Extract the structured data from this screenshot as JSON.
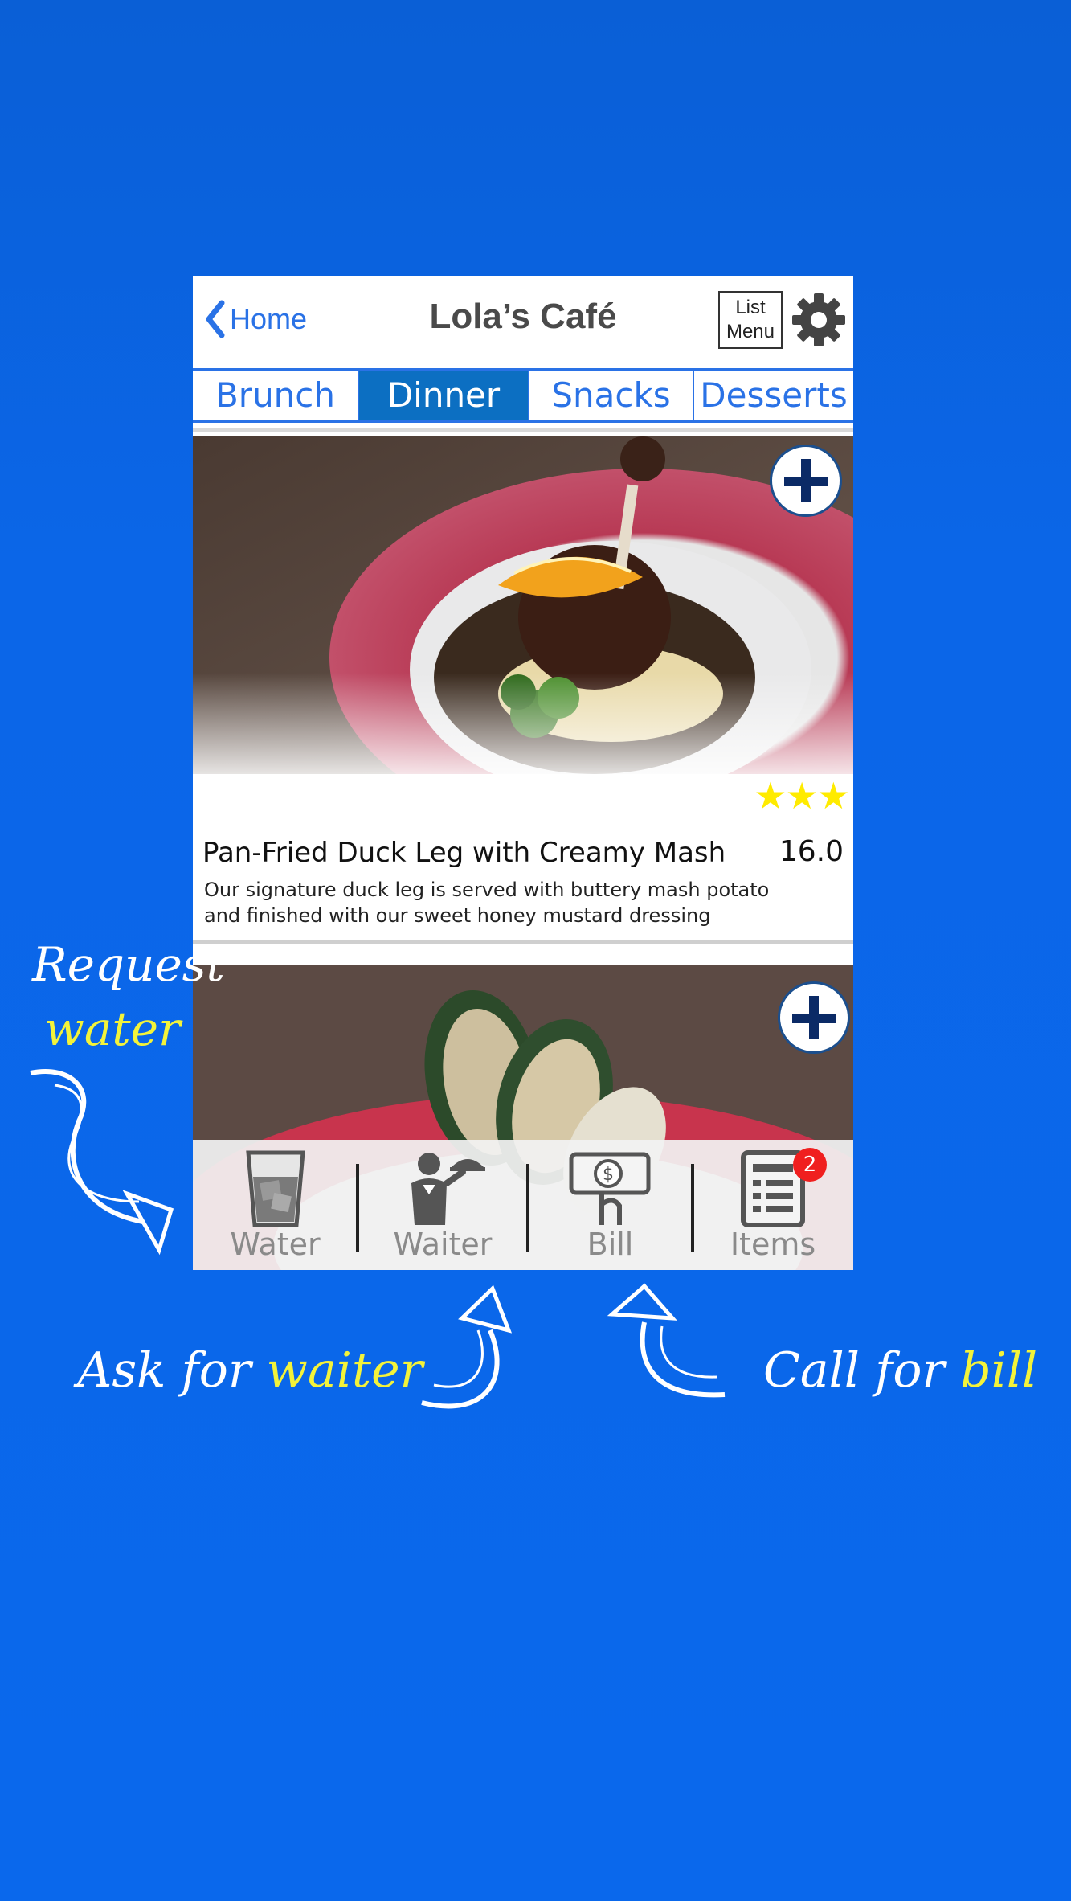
{
  "header": {
    "back_label": "Home",
    "title": "Lola’s Café",
    "list_menu_line1": "List",
    "list_menu_line2": "Menu"
  },
  "tabs": [
    {
      "label": "Brunch",
      "active": false
    },
    {
      "label": "Dinner",
      "active": true
    },
    {
      "label": "Snacks",
      "active": false
    },
    {
      "label": "Desserts",
      "active": false
    }
  ],
  "dish1": {
    "name": "Pan-Fried Duck Leg with Creamy Mash",
    "price": "16.0",
    "rating": "★★★",
    "description": "Our signature duck leg is served with buttery mash potato and finished with our sweet honey mustard dressing"
  },
  "bottom_bar": {
    "water": "Water",
    "waiter": "Waiter",
    "bill": "Bill",
    "items": "Items",
    "items_count": "2"
  },
  "annotations": {
    "request_line1": "Request",
    "request_line2": "water",
    "ask_prefix": "Ask for ",
    "ask_highlight": "waiter",
    "call_prefix": "Call for ",
    "call_highlight": "bill"
  },
  "colors": {
    "accent": "#2a72e6",
    "active_tab": "#0c6fc2",
    "background": "#0a68ec",
    "highlight": "#f3f33a",
    "badge": "#f01f1f"
  }
}
